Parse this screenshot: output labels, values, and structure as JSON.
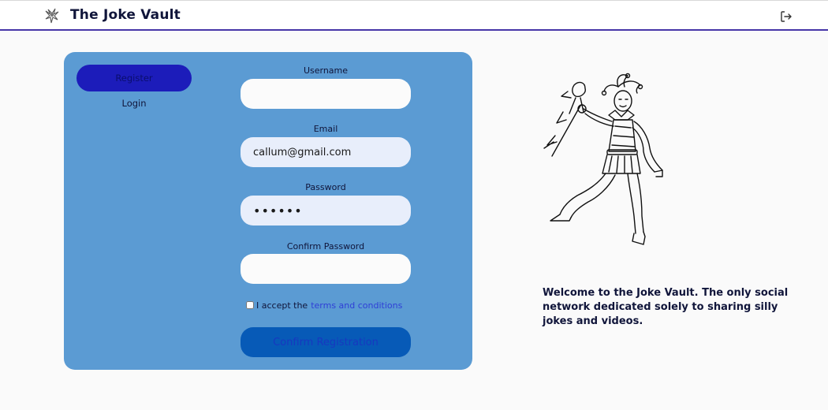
{
  "header": {
    "title": "The Joke Vault",
    "logo_icon": "jester-icon",
    "logout_icon": "logout-icon"
  },
  "auth_panel": {
    "tabs": {
      "register_label": "Register",
      "login_label": "Login"
    },
    "fields": {
      "username": {
        "label": "Username",
        "value": ""
      },
      "email": {
        "label": "Email",
        "value": "callum@gmail.com"
      },
      "password": {
        "label": "Password",
        "value": "••••••"
      },
      "confirm_password": {
        "label": "Confirm Password",
        "value": ""
      }
    },
    "terms": {
      "prefix": "I accept the",
      "link_text": "terms and conditions",
      "checked": false
    },
    "submit_label": "Confirm Registration"
  },
  "welcome_text": "Welcome to the Joke Vault. The only social network dedicated solely to sharing silly jokes and videos.",
  "colors": {
    "panel": "#5b9bd3",
    "active_tab": "#1c1cba",
    "submit_button": "#075ab7",
    "link": "#2f3fd6",
    "header_border": "#4636a8"
  }
}
